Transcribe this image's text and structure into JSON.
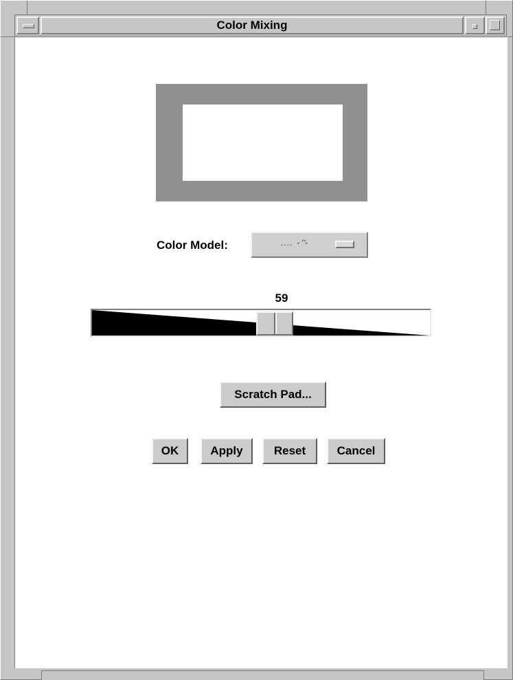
{
  "window": {
    "title": "Color Mixing",
    "menu_icon": "window-menu-icon",
    "minimize_icon": "minimize-icon",
    "maximize_icon": "maximize-icon"
  },
  "swatch": {
    "border_color": "#909090",
    "fill_color": "#ffffff"
  },
  "color_model": {
    "label": "Color Model:",
    "value": ".... -''-",
    "indicator_icon": "option-menu-indicator-icon"
  },
  "slider": {
    "value": "59",
    "min": 0,
    "max": 100
  },
  "buttons": {
    "scratch_pad": "Scratch Pad...",
    "ok": "OK",
    "apply": "Apply",
    "reset": "Reset",
    "cancel": "Cancel"
  }
}
